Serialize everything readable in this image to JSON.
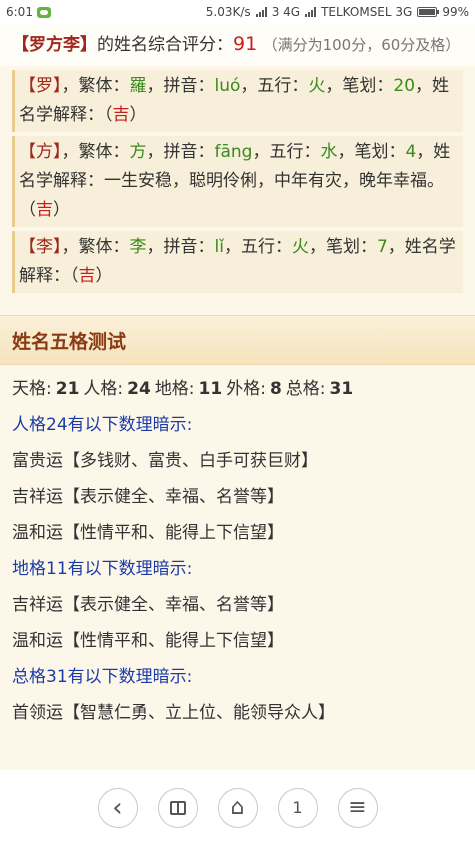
{
  "status": {
    "time": "6:01",
    "speed": "5.03K/s",
    "network1": "3 4G",
    "carrier": "TELKOMSEL 3G",
    "battery": "99%"
  },
  "summary": {
    "name": "【罗方李】",
    "text1": "的姓名综合评分：",
    "score": "91",
    "note": "（满分为100分，60分及格）"
  },
  "chars": [
    {
      "char": "罗",
      "trad": "羅",
      "pinyin": "luó",
      "element": "火",
      "strokes": "20",
      "explain": "",
      "luck": "吉"
    },
    {
      "char": "方",
      "trad": "方",
      "pinyin": "fāng",
      "element": "水",
      "strokes": "4",
      "explain": "一生安稳，聪明伶俐，中年有灾，晚年幸福。",
      "luck": "吉"
    },
    {
      "char": "李",
      "trad": "李",
      "pinyin": "lǐ",
      "element": "火",
      "strokes": "7",
      "explain": "",
      "luck": "吉"
    }
  ],
  "labels": {
    "trad": "，繁体：",
    "pinyin": "，拼音：",
    "element": "，五行：",
    "strokes": "，笔划：",
    "explain": "，姓名学解释：",
    "explain_nocomma": "姓名学解释："
  },
  "wuge": {
    "title": "姓名五格测试",
    "scores": [
      {
        "label": "天格:",
        "value": "21"
      },
      {
        "label": "人格:",
        "value": "24"
      },
      {
        "label": "地格:",
        "value": "11"
      },
      {
        "label": "外格:",
        "value": "8"
      },
      {
        "label": "总格:",
        "value": "31"
      }
    ],
    "lines": [
      {
        "text": "人格24有以下数理暗示:",
        "type": "head"
      },
      {
        "text": "富贵运【多钱财、富贵、白手可获巨财】",
        "type": "item"
      },
      {
        "text": "吉祥运【表示健全、幸福、名誉等】",
        "type": "item"
      },
      {
        "text": "温和运【性情平和、能得上下信望】",
        "type": "item"
      },
      {
        "text": "地格11有以下数理暗示:",
        "type": "head"
      },
      {
        "text": "吉祥运【表示健全、幸福、名誉等】",
        "type": "item"
      },
      {
        "text": "温和运【性情平和、能得上下信望】",
        "type": "item"
      },
      {
        "text": "总格31有以下数理暗示:",
        "type": "head"
      },
      {
        "text": "首领运【智慧仁勇、立上位、能领导众人】",
        "type": "item"
      }
    ]
  },
  "nav": {
    "back_icon": "‹",
    "book_icon": "□",
    "home_icon": "⌂",
    "tabs_count": "1",
    "menu_icon": "≡"
  }
}
